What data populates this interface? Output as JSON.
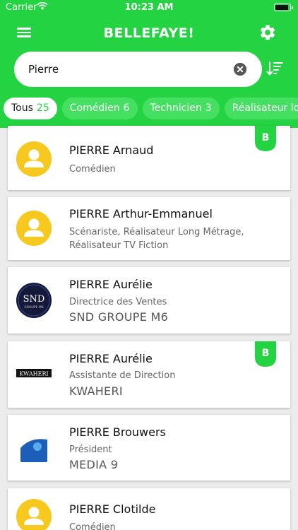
{
  "status_bar": {
    "carrier": "Carrier",
    "time": "10:23 AM",
    "battery_level": 0.9
  },
  "header": {
    "title": "BELLEFAYE!"
  },
  "search": {
    "value": "Pierre"
  },
  "filters": [
    {
      "label": "Tous",
      "count": "25",
      "active": true
    },
    {
      "label": "Comédien",
      "count": "6",
      "active": false
    },
    {
      "label": "Technicien",
      "count": "3",
      "active": false
    },
    {
      "label": "Réalisateur lo",
      "count": "",
      "active": false
    }
  ],
  "results": [
    {
      "name": "PIERRE Arnaud",
      "role": "Comédien",
      "badge": "B"
    },
    {
      "name": "PIERRE Arthur-Emmanuel",
      "role": "Scénariste, Réalisateur Long Métrage, Réalisateur TV Fiction"
    },
    {
      "name": "PIERRE Aurélie",
      "role": "Directrice des Ventes",
      "company": "SND GROUPE M6",
      "logo_text": "SND",
      "logo_subtext": "GROUPE M6"
    },
    {
      "name": "PIERRE Aurélie",
      "role": "Assistante de Direction",
      "company": "KWAHERI",
      "badge": "B",
      "logo_text": "KWAHERI"
    },
    {
      "name": "PIERRE Brouwers",
      "role": "Président",
      "company": "MEDIA 9"
    },
    {
      "name": "PIERRE Clotilde",
      "role": "Comédien"
    }
  ],
  "colors": {
    "brand_green": "#23d341",
    "avatar_yellow": "#f7c81e"
  }
}
